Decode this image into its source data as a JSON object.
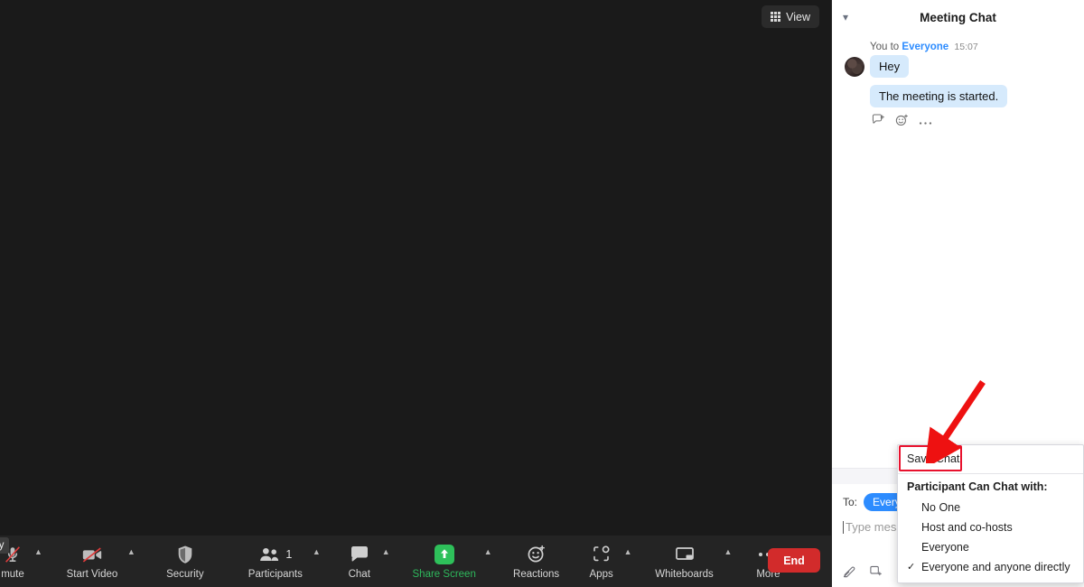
{
  "stage": {
    "view_button": {
      "label": "View",
      "icon": "grid-icon"
    },
    "background_color": "#1a1a1a"
  },
  "toolbar": {
    "background_color": "#242424",
    "tooltip_fragment": "vely",
    "items": [
      {
        "label": "mute",
        "icon": "microphone-muted-icon",
        "has_caret": true,
        "color": "#d6d6d6"
      },
      {
        "label": "Start Video",
        "icon": "video-camera-muted-icon",
        "has_caret": true,
        "color": "#d6d6d6"
      },
      {
        "label": "Security",
        "icon": "shield-icon",
        "has_caret": false,
        "color": "#d6d6d6"
      },
      {
        "label": "Participants",
        "icon": "people-icon",
        "badge": "1",
        "has_caret": true,
        "color": "#d6d6d6"
      },
      {
        "label": "Chat",
        "icon": "speech-bubble-icon",
        "has_caret": true,
        "color": "#d6d6d6"
      },
      {
        "label": "Share Screen",
        "icon": "share-screen-up-arrow-icon",
        "has_caret": true,
        "color": "#2eb85c"
      },
      {
        "label": "Reactions",
        "icon": "smiley-reaction-icon",
        "has_caret": false,
        "color": "#d6d6d6"
      },
      {
        "label": "Apps",
        "icon": "apps-icon",
        "has_caret": true,
        "color": "#d6d6d6"
      },
      {
        "label": "Whiteboards",
        "icon": "whiteboard-icon",
        "has_caret": true,
        "color": "#d6d6d6"
      },
      {
        "label": "More",
        "icon": "ellipsis-icon",
        "has_caret": false,
        "color": "#d6d6d6"
      }
    ],
    "end_button": {
      "label": "End",
      "color": "#d22b2b"
    }
  },
  "chat": {
    "title": "Meeting Chat",
    "collapse_icon": "chevron-down-icon",
    "message": {
      "sender": "You",
      "to_prefix": "You to",
      "recipient": "Everyone",
      "timestamp": "15:07",
      "bubbles": [
        "Hey",
        "The meeting is started."
      ],
      "actions": [
        "reply-icon",
        "emoji-reaction-icon",
        "more-options-icon"
      ]
    },
    "compose": {
      "to_label": "To:",
      "to_value": "Everyone",
      "placeholder": "Type message here...",
      "icons": [
        "format-text-icon",
        "screenshot-icon",
        "file-icon"
      ]
    }
  },
  "context_menu": {
    "save_chat": "Save Chat",
    "group_title": "Participant Can Chat with:",
    "options": [
      {
        "label": "No One",
        "checked": false
      },
      {
        "label": "Host and co-hosts",
        "checked": false
      },
      {
        "label": "Everyone",
        "checked": false
      },
      {
        "label": "Everyone and anyone directly",
        "checked": true
      }
    ],
    "highlight_color": "#e8112d"
  },
  "annotation": {
    "arrow_color": "#ee1111",
    "arrow_target": "Save Chat"
  }
}
